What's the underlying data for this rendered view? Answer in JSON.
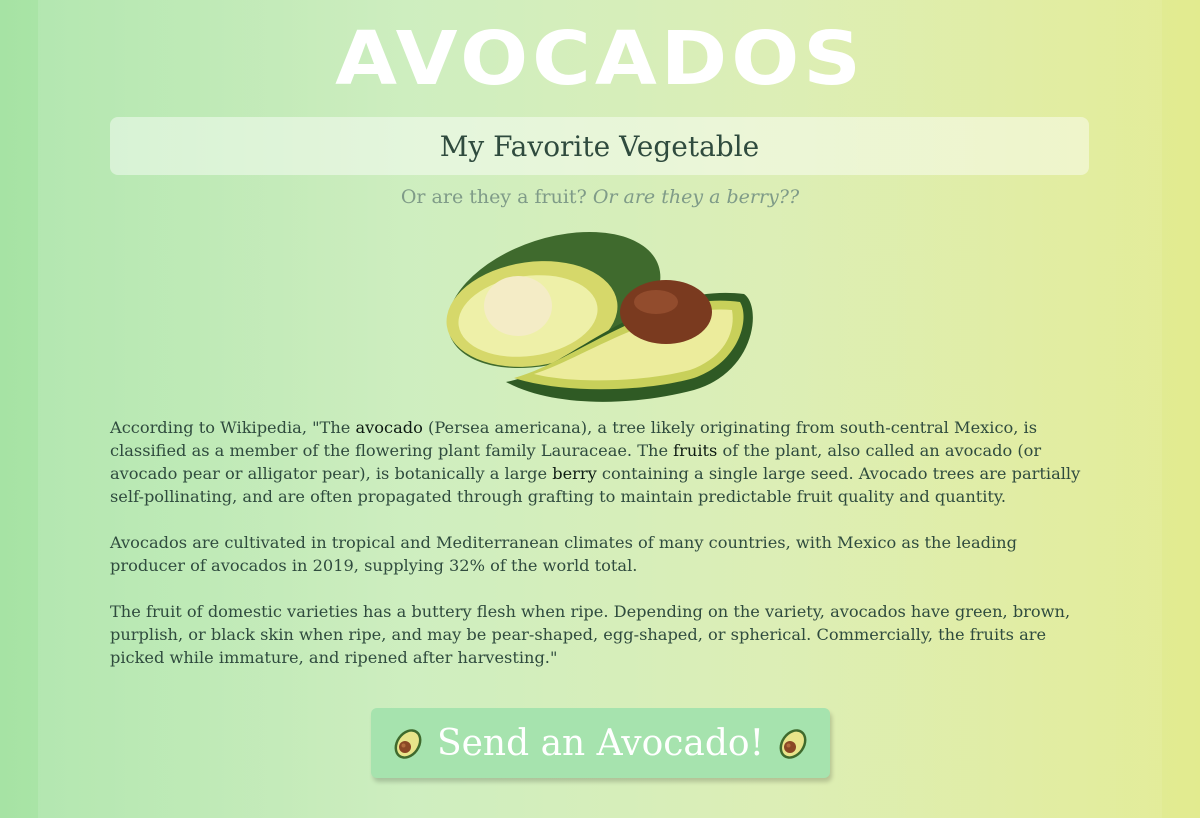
{
  "header": {
    "title": "AVOCADOS",
    "subtitle": "My Favorite Vegetable",
    "tagline_plain": "Or are they a fruit?",
    "tagline_italic": "Or are they a berry??"
  },
  "hero_image": {
    "icon": "avocado-halves-image"
  },
  "article": {
    "p1_a": "According to Wikipedia, \"The ",
    "p1_b": "avocado",
    "p1_c": " (Persea americana), a tree likely originating from south-central Mexico, is classified as a member of the flowering plant family Lauraceae. The ",
    "p1_d": "fruits",
    "p1_e": " of the plant, also called an avocado (or avocado pear or alligator pear), is botanically a large ",
    "p1_f": "berry",
    "p1_g": " containing a single large seed. Avocado trees are partially self-pollinating, and are often propagated through grafting to maintain predictable fruit quality and quantity.",
    "p2": "Avocados are cultivated in tropical and Mediterranean climates of many countries, with Mexico as the leading producer of avocados in 2019, supplying 32% of the world total.",
    "p3": "The fruit of domestic varieties has a buttery flesh when ripe. Depending on the variety, avocados have green, brown, purplish, or black skin when ripe, and may be pear-shaped, egg-shaped, or spherical. Commercially, the fruits are picked while immature, and ripened after harvesting.\""
  },
  "cta": {
    "label": "Send an Avocado!",
    "icon": "avocado-emoji-icon"
  },
  "colors": {
    "background_left": "#a6e3a4",
    "background_right": "#e2eb8f",
    "title": "#ffffff",
    "text": "#2f4b3e",
    "button": "#a6e3ae"
  }
}
